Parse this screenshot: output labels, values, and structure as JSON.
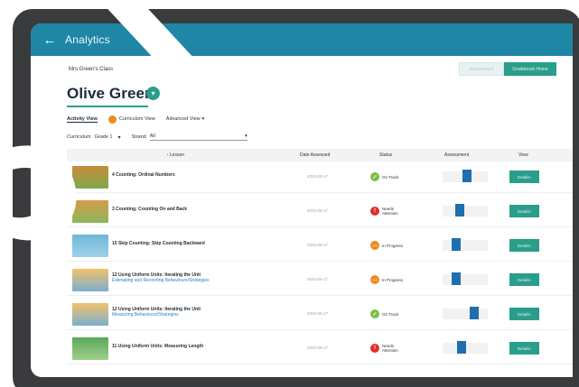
{
  "app": {
    "title": "Analytics"
  },
  "class_select": {
    "value": "Mrs.Green's Class"
  },
  "buttons": {
    "assessment": "Assessment",
    "gradebook": "Gradebook Home"
  },
  "student": {
    "name": "Olive Green"
  },
  "views": {
    "activity": "Activity View",
    "curriculum": "Curriculum View",
    "advanced": "Advanced View"
  },
  "filters": {
    "curriculum_label": "Curriculum",
    "curriculum_value": "Grade 1",
    "strand_label": "Strand",
    "strand_value": "All"
  },
  "table": {
    "headers": {
      "lesson": "Lesson",
      "date": "Date Assessed",
      "status": "Status",
      "assessment": "Assessment",
      "view": "View"
    },
    "rows": [
      {
        "lesson": "4 Counting: Ordinal Numbers",
        "sub": "",
        "date": "2023-05-17",
        "status": "On Track",
        "status_color": "green",
        "assessment_level": 0.55,
        "view": "Details"
      },
      {
        "lesson": "3 Counting: Counting On and Back",
        "sub": "",
        "date": "2023-05-17",
        "status": "Needs Attention",
        "status_color": "red",
        "assessment_level": 0.35,
        "view": "Details"
      },
      {
        "lesson": "15 Skip Counting: Skip Counting Backward",
        "sub": "",
        "date": "2023-05-17",
        "status": "In Progress",
        "status_color": "orange",
        "assessment_level": 0.25,
        "view": "Details"
      },
      {
        "lesson": "12 Using Uniform Units: Iterating the Unit",
        "sub": "Estimating and Recording Behaviours/Strategies",
        "date": "2023-05-17",
        "status": "In Progress",
        "status_color": "orange",
        "assessment_level": 0.25,
        "view": "Details"
      },
      {
        "lesson": "12 Using Uniform Units: Iterating the Unit",
        "sub": "Measuring Behaviours/Strategies",
        "date": "2023-05-17",
        "status": "On Track",
        "status_color": "green",
        "assessment_level": 0.75,
        "view": "Details"
      },
      {
        "lesson": "11 Using Uniform Units: Measuring Length",
        "sub": "",
        "date": "2023-05-17",
        "status": "Needs Attention",
        "status_color": "red",
        "assessment_level": 0.4,
        "view": "Details"
      }
    ]
  },
  "colors": {
    "appbar": "#1f86a6",
    "accent": "#2a9e8a",
    "frame": "#3a3b3d"
  }
}
